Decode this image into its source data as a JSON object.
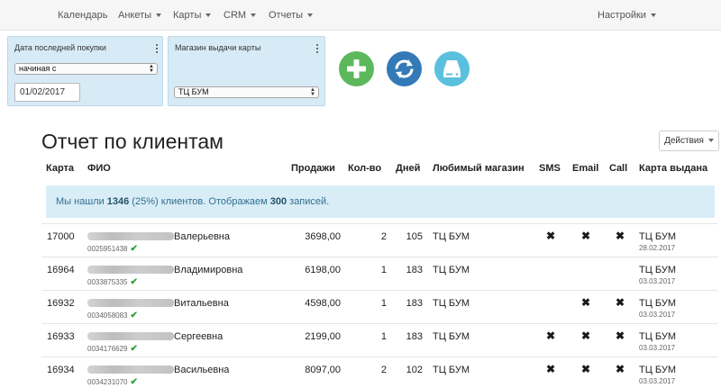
{
  "nav": {
    "items": [
      {
        "label": "Календарь",
        "caret": false
      },
      {
        "label": "Анкеты",
        "caret": true
      },
      {
        "label": "Карты",
        "caret": true
      },
      {
        "label": "CRM",
        "caret": true
      },
      {
        "label": "Отчеты",
        "caret": true
      }
    ],
    "settings": {
      "label": "Настройки",
      "caret": true
    }
  },
  "filters": [
    {
      "title": "Дата последней покупки",
      "select": "начиная с",
      "date": "01/02/2017"
    },
    {
      "title": "Магазин выдачи карты",
      "select": "ТЦ БУМ"
    }
  ],
  "buttons": {
    "add": {
      "icon": "plus-icon",
      "color": "#5cb85c"
    },
    "refresh": {
      "icon": "refresh-icon",
      "color": "#337ab7"
    },
    "storage": {
      "icon": "hard-drive-icon",
      "color": "#5bc0de"
    }
  },
  "report": {
    "title": "Отчет по клиентам",
    "actions_label": "Действия"
  },
  "table": {
    "headers": {
      "card": "Карта",
      "name": "ФИО",
      "sales": "Продажи",
      "qty": "Кол-во",
      "days": "Дней",
      "shop": "Любимый магазин",
      "sms": "SMS",
      "email": "Email",
      "call": "Call",
      "issued": "Карта выдана"
    },
    "info": {
      "p1": "Мы нашли ",
      "found": "1346",
      "p2": " (25%) клиентов. Отображаем ",
      "shown": "300",
      "p3": " записей."
    },
    "rows": [
      {
        "card": "17000",
        "name": "Валерьевна",
        "phone": "0025951438",
        "sales": "3698,00",
        "qty": "2",
        "days": "105",
        "shop": "ТЦ БУМ",
        "sms": "✖",
        "email": "✖",
        "call": "✖",
        "issued_shop": "ТЦ БУМ",
        "issued_date": "28.02.2017"
      },
      {
        "card": "16964",
        "name": "Владимировна",
        "phone": "0033875335",
        "sales": "6198,00",
        "qty": "1",
        "days": "183",
        "shop": "ТЦ БУМ",
        "sms": "",
        "email": "",
        "call": "",
        "issued_shop": "ТЦ БУМ",
        "issued_date": "03.03.2017"
      },
      {
        "card": "16932",
        "name": "Витальевна",
        "phone": "0034058083",
        "sales": "4598,00",
        "qty": "1",
        "days": "183",
        "shop": "ТЦ БУМ",
        "sms": "",
        "email": "✖",
        "call": "✖",
        "issued_shop": "ТЦ БУМ",
        "issued_date": "03.03.2017"
      },
      {
        "card": "16933",
        "name": "Сергеевна",
        "phone": "0034176629",
        "sales": "2199,00",
        "qty": "1",
        "days": "183",
        "shop": "ТЦ БУМ",
        "sms": "✖",
        "email": "✖",
        "call": "✖",
        "issued_shop": "ТЦ БУМ",
        "issued_date": "03.03.2017"
      },
      {
        "card": "16934",
        "name": "Васильевна",
        "phone": "0034231070",
        "sales": "8097,00",
        "qty": "2",
        "days": "102",
        "shop": "ТЦ БУМ",
        "sms": "✖",
        "email": "✖",
        "call": "✖",
        "issued_shop": "ТЦ БУМ",
        "issued_date": "03.03.2017"
      }
    ]
  }
}
